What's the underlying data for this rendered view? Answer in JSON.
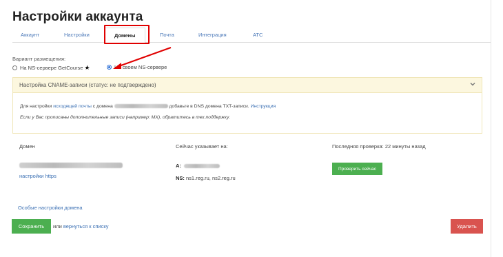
{
  "page": {
    "title": "Настройки аккаунта"
  },
  "tabs": [
    {
      "label": "Аккаунт"
    },
    {
      "label": "Настройки"
    },
    {
      "label": "Домены",
      "active": true
    },
    {
      "label": "Почта"
    },
    {
      "label": "Интеграция"
    },
    {
      "label": "АТС"
    }
  ],
  "placement": {
    "label": "Вариант размещения:",
    "options": [
      {
        "label": "На NS-сервере GetCourse",
        "checked": false
      },
      {
        "label": "На своем NS-сервере",
        "checked": true
      }
    ],
    "star": "★"
  },
  "cname": {
    "title": "Настройка CNAME-записи (статус: не подтверждено)",
    "line1_prefix": "Для настройки",
    "line1_link": "исходящей почты",
    "line1_mid": "с домена",
    "line1_suffix": "добавьте в DNS домена TXT-записи.",
    "line1_instruction": "Инструкция",
    "line2": "Если у Вас прописаны дополнительные записи (например: MX), обратитесь в тех.поддержку."
  },
  "domain_table": {
    "col_domain": "Домен",
    "col_current": "Сейчас указывает на:",
    "col_last_check": "Последняя проверка: 22 минуты назад",
    "https_link": "настройки https",
    "a_label": "A:",
    "ns_label": "NS:",
    "ns_value": "ns1.reg.ru, ns2.reg.ru",
    "check_button": "Проверить сейчас"
  },
  "special_settings_link": "Особые настройки домена",
  "footer": {
    "save_button": "Сохранить",
    "or_text": "или",
    "back_link": "вернуться к списку",
    "delete_button": "Удалить"
  },
  "colors": {
    "accent_green": "#4caf50",
    "danger_red": "#d9534f",
    "link_blue": "#3a6fb3",
    "highlight_red": "#e00000",
    "panel_yellow": "#fcf7df"
  }
}
